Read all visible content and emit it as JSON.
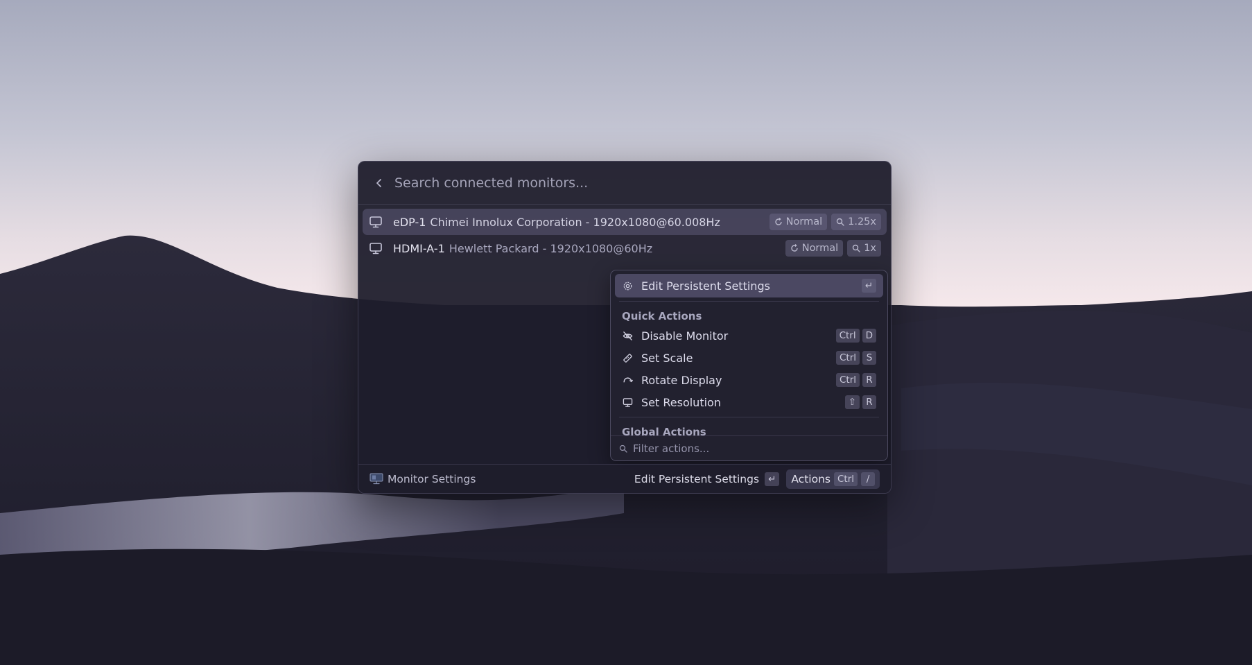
{
  "search": {
    "placeholder": "Search connected monitors..."
  },
  "monitors": [
    {
      "id": "eDP-1",
      "description": "Chimei Innolux Corporation - 1920x1080@60.008Hz",
      "transform": "Normal",
      "scale": "1.25x",
      "selected": true
    },
    {
      "id": "HDMI-A-1",
      "description": "Hewlett Packard - 1920x1080@60Hz",
      "transform": "Normal",
      "scale": "1x",
      "selected": false
    }
  ],
  "action_panel": {
    "primary": {
      "label": "Edit Persistent Settings",
      "shortcut": "↵",
      "icon": "gear-icon"
    },
    "quick_actions_title": "Quick Actions",
    "quick_actions": [
      {
        "label": "Disable Monitor",
        "keys": [
          "Ctrl",
          "D"
        ],
        "icon": "eye-off-icon"
      },
      {
        "label": "Set Scale",
        "keys": [
          "Ctrl",
          "S"
        ],
        "icon": "ruler-icon"
      },
      {
        "label": "Rotate Display",
        "keys": [
          "Ctrl",
          "R"
        ],
        "icon": "rotate-icon"
      },
      {
        "label": "Set Resolution",
        "keys": [
          "⇧",
          "R"
        ],
        "icon": "monitor-icon"
      }
    ],
    "global_actions_title": "Global Actions",
    "filter_placeholder": "Filter actions..."
  },
  "footer": {
    "title": "Monitor Settings",
    "primary_action": "Edit Persistent Settings",
    "primary_shortcut": "↵",
    "actions_label": "Actions",
    "actions_keys": [
      "Ctrl",
      "/"
    ]
  }
}
